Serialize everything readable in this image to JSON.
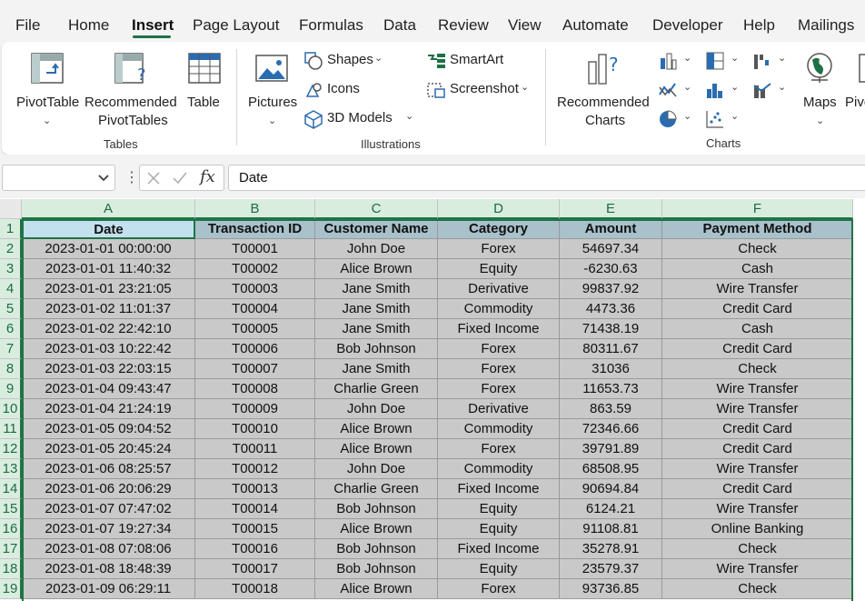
{
  "menu": {
    "tabs": [
      "File",
      "Home",
      "Insert",
      "Page Layout",
      "Formulas",
      "Data",
      "Review",
      "View",
      "Automate",
      "Developer",
      "Help",
      "Mailings"
    ],
    "active_tab": "Insert"
  },
  "ribbon": {
    "tables": {
      "pivot_line1": "PivotTable",
      "recommended_line1": "Recommended",
      "recommended_line2": "PivotTables",
      "table": "Table",
      "group_label": "Tables"
    },
    "illustrations": {
      "pictures": "Pictures",
      "shapes": "Shapes",
      "icons": "Icons",
      "models": "3D Models",
      "smartart": "SmartArt",
      "screenshot": "Screenshot",
      "group_label": "Illustrations"
    },
    "charts": {
      "rec_line1": "Recommended",
      "rec_line2": "Charts",
      "maps": "Maps",
      "pivot_partial": "Pivo",
      "group_label": "Charts"
    }
  },
  "formula_bar": {
    "name_box_value": "",
    "fx_label": "fx",
    "formula": "Date"
  },
  "sheet": {
    "columns": [
      "A",
      "B",
      "C",
      "D",
      "E",
      "F"
    ],
    "header_row": [
      "Date",
      "Transaction ID",
      "Customer Name",
      "Category",
      "Amount",
      "Payment Method"
    ],
    "row_numbers": [
      "1",
      "2",
      "3",
      "4",
      "5",
      "6",
      "7",
      "8",
      "9",
      "10",
      "11",
      "12",
      "13",
      "14",
      "15",
      "16",
      "17",
      "18",
      "19"
    ],
    "rows": [
      [
        "2023-01-01 00:00:00",
        "T00001",
        "John Doe",
        "Forex",
        "54697.34",
        "Check"
      ],
      [
        "2023-01-01 11:40:32",
        "T00002",
        "Alice Brown",
        "Equity",
        "-6230.63",
        "Cash"
      ],
      [
        "2023-01-01 23:21:05",
        "T00003",
        "Jane Smith",
        "Derivative",
        "99837.92",
        "Wire Transfer"
      ],
      [
        "2023-01-02 11:01:37",
        "T00004",
        "Jane Smith",
        "Commodity",
        "4473.36",
        "Credit Card"
      ],
      [
        "2023-01-02 22:42:10",
        "T00005",
        "Jane Smith",
        "Fixed Income",
        "71438.19",
        "Cash"
      ],
      [
        "2023-01-03 10:22:42",
        "T00006",
        "Bob Johnson",
        "Forex",
        "80311.67",
        "Credit Card"
      ],
      [
        "2023-01-03 22:03:15",
        "T00007",
        "Jane Smith",
        "Forex",
        "31036",
        "Check"
      ],
      [
        "2023-01-04 09:43:47",
        "T00008",
        "Charlie Green",
        "Forex",
        "11653.73",
        "Wire Transfer"
      ],
      [
        "2023-01-04 21:24:19",
        "T00009",
        "John Doe",
        "Derivative",
        "863.59",
        "Wire Transfer"
      ],
      [
        "2023-01-05 09:04:52",
        "T00010",
        "Alice Brown",
        "Commodity",
        "72346.66",
        "Credit Card"
      ],
      [
        "2023-01-05 20:45:24",
        "T00011",
        "Alice Brown",
        "Forex",
        "39791.89",
        "Credit Card"
      ],
      [
        "2023-01-06 08:25:57",
        "T00012",
        "John Doe",
        "Commodity",
        "68508.95",
        "Wire Transfer"
      ],
      [
        "2023-01-06 20:06:29",
        "T00013",
        "Charlie Green",
        "Fixed Income",
        "90694.84",
        "Credit Card"
      ],
      [
        "2023-01-07 07:47:02",
        "T00014",
        "Bob Johnson",
        "Equity",
        "6124.21",
        "Wire Transfer"
      ],
      [
        "2023-01-07 19:27:34",
        "T00015",
        "Alice Brown",
        "Equity",
        "91108.81",
        "Online Banking"
      ],
      [
        "2023-01-08 07:08:06",
        "T00016",
        "Bob Johnson",
        "Fixed Income",
        "35278.91",
        "Check"
      ],
      [
        "2023-01-08 18:48:39",
        "T00017",
        "Bob Johnson",
        "Equity",
        "23579.37",
        "Wire Transfer"
      ],
      [
        "2023-01-09 06:29:11",
        "T00018",
        "Alice Brown",
        "Forex",
        "93736.85",
        "Check"
      ]
    ]
  },
  "colors": {
    "accent": "#217346",
    "header_fill": "#a8c1cb",
    "data_fill": "#c9c9c9"
  }
}
